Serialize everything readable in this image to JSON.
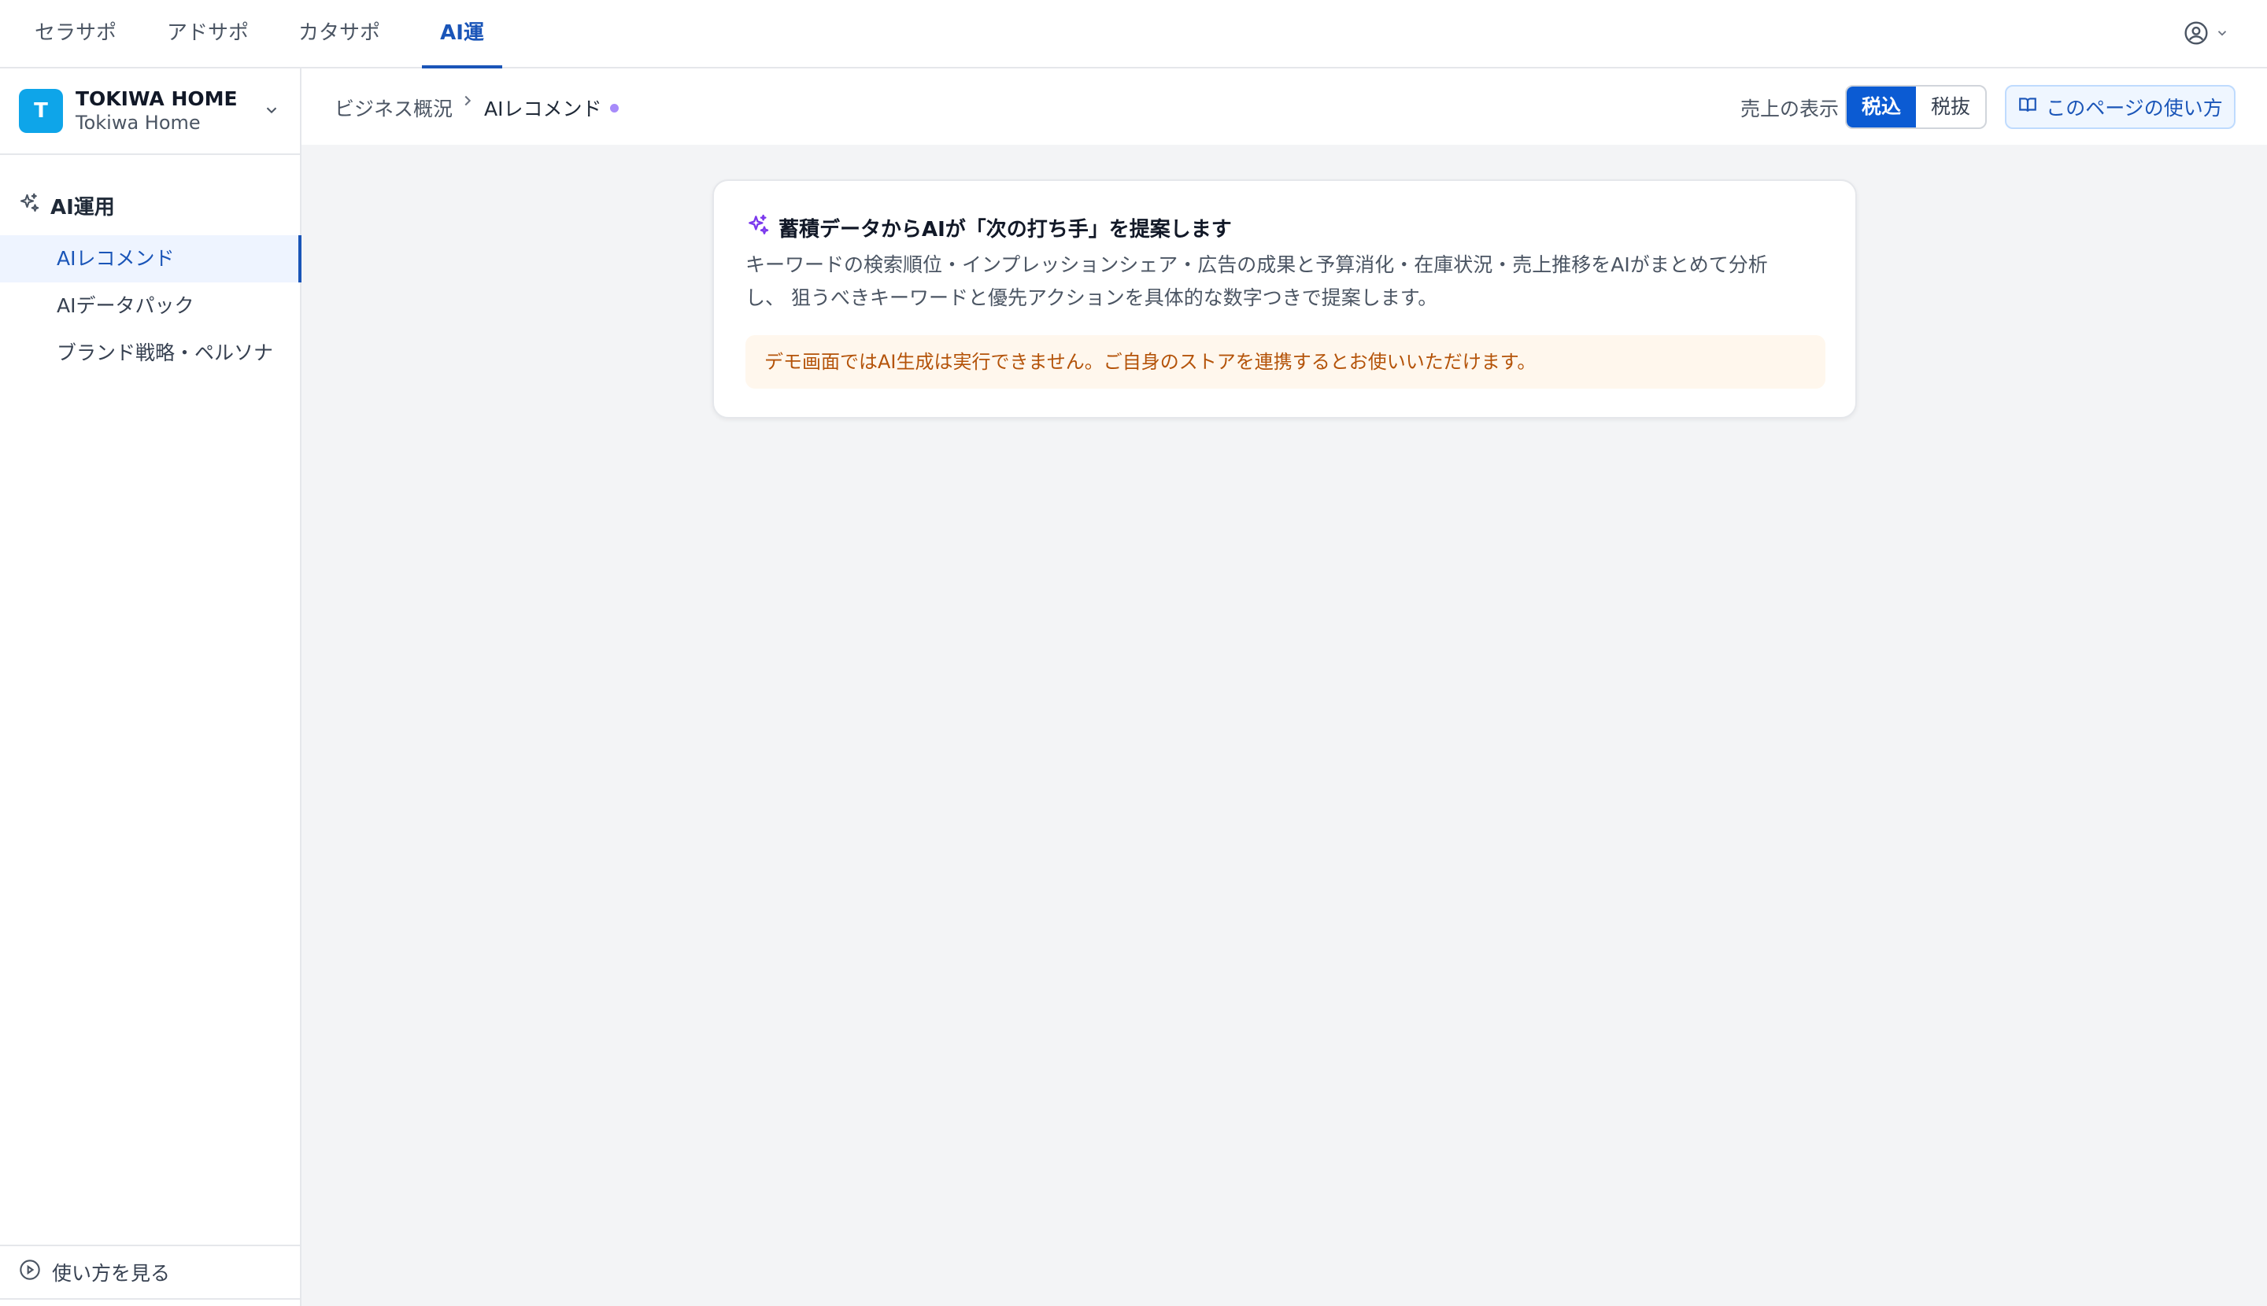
{
  "topnav": {
    "tabs": [
      {
        "label": "セラサポ"
      },
      {
        "label": "アドサポ"
      },
      {
        "label": "カタサポ"
      },
      {
        "label": "AI運用"
      }
    ],
    "active_tab": "AI運用",
    "user_icon": "user-circle-icon"
  },
  "sidebar": {
    "org": {
      "avatar_letter": "T",
      "name": "TOKIWA HOME",
      "sub": "Tokiwa Home"
    },
    "section_title": "AI運用",
    "section_icon": "sparkles-icon",
    "items": [
      {
        "label": "AIレコメンド"
      },
      {
        "label": "AIデータパック"
      },
      {
        "label": "ブランド戦略・ペルソナ"
      }
    ],
    "active_item": "AIレコメンド",
    "footer_label": "使い方を見る",
    "footer_icon": "play-circle-icon"
  },
  "header": {
    "breadcrumb_root": "ビジネス概況",
    "breadcrumb_current": "AIレコメンド",
    "tax_label": "売上の表示",
    "tax_options": [
      "税込",
      "税抜"
    ],
    "tax_selected": "税込",
    "guide_label": "このページの使い方",
    "guide_icon": "book-icon"
  },
  "card": {
    "icon": "sparkles-icon",
    "title": "蓄積データからAIが「次の打ち手」を提案します",
    "desc_line1": "キーワードの検索順位・インプレッションシェア・広告の成果と予算消化・在庫状況・売上推移をAIがまとめて分析",
    "desc_line2": "し、 狙うべきキーワードと優先アクションを具体的な数字つきで提案します。",
    "notice": "デモ画面ではAI生成は実行できません。ご自身のストアを連携するとお使いいただけます。"
  },
  "colors": {
    "accent": "#1a55b8",
    "toggle_active": "#0b5bd3",
    "org_avatar": "#0ea5e9",
    "notice_bg": "#fff7ed",
    "notice_text": "#b45309",
    "status_dot": "#a78bfa"
  }
}
